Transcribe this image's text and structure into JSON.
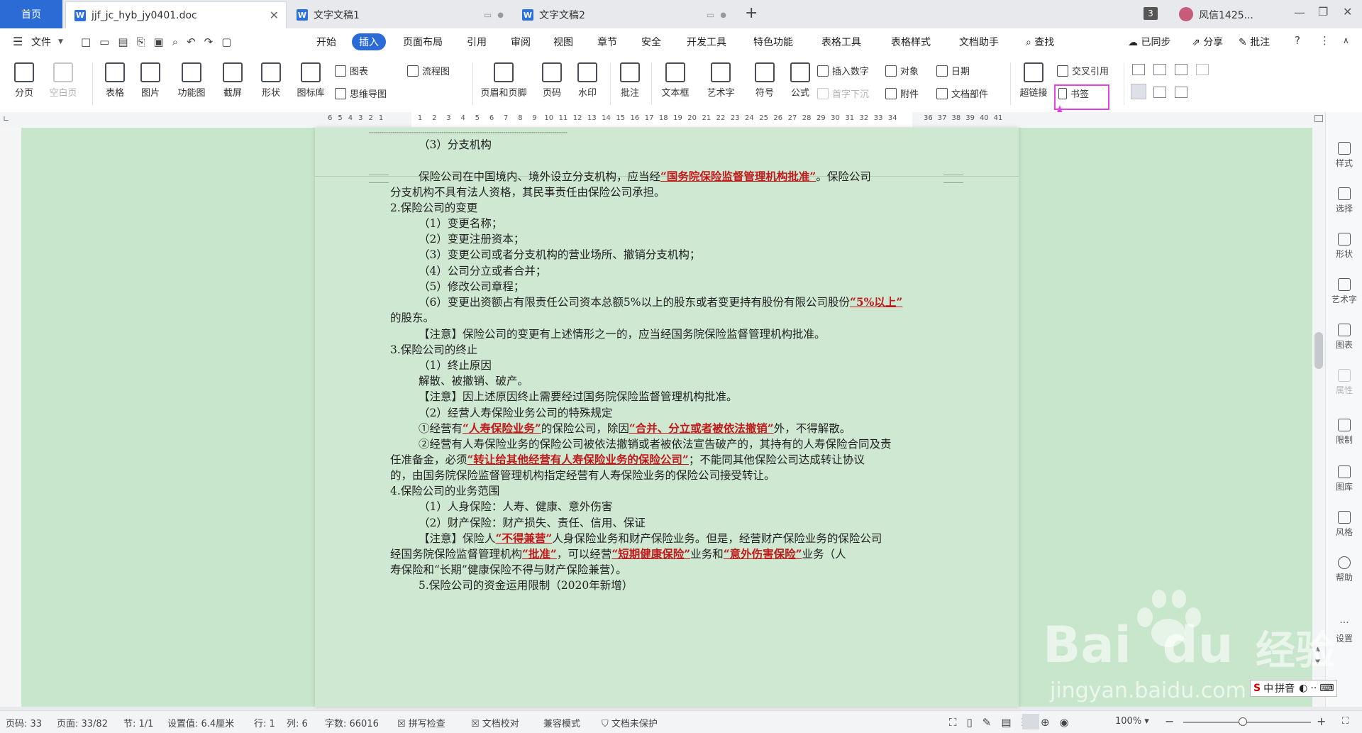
{
  "tabs": {
    "home": "首页",
    "items": [
      {
        "label": "jjf_jc_hyb_jy0401.doc",
        "icon": "W"
      },
      {
        "label": "文字文稿1",
        "icon": "W"
      },
      {
        "label": "文字文稿2",
        "icon": "W"
      }
    ],
    "new_tab": "+",
    "badge": "3",
    "user": "风信1425..."
  },
  "menubar": {
    "file": "文件",
    "items": [
      "开始",
      "插入",
      "页面布局",
      "引用",
      "审阅",
      "视图",
      "章节",
      "安全",
      "开发工具",
      "特色功能",
      "表格工具",
      "表格样式",
      "文档助手"
    ],
    "active": "插入",
    "search": "查找",
    "sync": "已同步",
    "share": "分享",
    "comment": "批注"
  },
  "ribbon": {
    "page_break": "分页",
    "blank_page": "空白页",
    "table": "表格",
    "picture": "图片",
    "function_chart": "功能图",
    "screenshot": "截屏",
    "shape": "形状",
    "icon_lib": "图标库",
    "chart": "图表",
    "mindmap": "思维导图",
    "flowchart": "流程图",
    "header_footer": "页眉和页脚",
    "page_number": "页码",
    "watermark": "水印",
    "comment": "批注",
    "textbox": "文本框",
    "wordart": "艺术字",
    "symbol": "符号",
    "formula": "公式",
    "insert_number": "插入数字",
    "object": "对象",
    "date": "日期",
    "dropcap": "首字下沉",
    "attachment": "附件",
    "doc_parts": "文档部件",
    "hyperlink": "超链接",
    "cross_ref": "交叉引用",
    "bookmark": "书签"
  },
  "ruler": {
    "left_ticks": [
      "6",
      "5",
      "4",
      "3",
      "2",
      "1"
    ],
    "ticks": [
      "1",
      "2",
      "3",
      "4",
      "5",
      "6",
      "7",
      "8",
      "9",
      "10",
      "11",
      "12",
      "13",
      "14",
      "15",
      "16",
      "17",
      "18",
      "19",
      "20",
      "21",
      "22",
      "23",
      "24",
      "25",
      "26",
      "27",
      "28",
      "29",
      "30",
      "31",
      "32",
      "33",
      "34"
    ],
    "right_ticks": [
      "36",
      "37",
      "38",
      "39",
      "40",
      "41"
    ]
  },
  "document": {
    "lines": [
      {
        "segs": [
          {
            "t": "（3）分支机构"
          }
        ]
      },
      {
        "segs": [
          {
            "t": "保险公司在中国境内、境外设立分支机构，应当经"
          },
          {
            "t": "“国务院保险监督管理机构批准”",
            "h": true
          },
          {
            "t": "。保险公司"
          }
        ]
      },
      {
        "segs": [
          {
            "t": "分支机构不具有法人资格，其民事责任由保险公司承担。"
          }
        ]
      },
      {
        "segs": [
          {
            "t": "2.保险公司的变更"
          }
        ]
      },
      {
        "segs": [
          {
            "t": "（1）变更名称；"
          }
        ]
      },
      {
        "segs": [
          {
            "t": "（2）变更注册资本；"
          }
        ]
      },
      {
        "segs": [
          {
            "t": "（3）变更公司或者分支机构的营业场所、撤销分支机构；"
          }
        ]
      },
      {
        "segs": [
          {
            "t": "（4）公司分立或者合并；"
          }
        ]
      },
      {
        "segs": [
          {
            "t": "（5）修改公司章程；"
          }
        ]
      },
      {
        "segs": [
          {
            "t": "（6）变更出资额占有限责任公司资本总额5%以上的股东或者变更持有股份有限公司股份"
          },
          {
            "t": "“5%以上”",
            "h": true
          }
        ]
      },
      {
        "segs": [
          {
            "t": "的股东。"
          }
        ]
      },
      {
        "segs": [
          {
            "t": "【注意】保险公司的变更有上述情形之一的，应当经国务院保险监督管理机构批准。"
          }
        ]
      },
      {
        "segs": [
          {
            "t": "3.保险公司的终止"
          }
        ]
      },
      {
        "segs": [
          {
            "t": "（1）终止原因"
          }
        ]
      },
      {
        "segs": [
          {
            "t": "解散、被撤销、破产。"
          }
        ]
      },
      {
        "segs": [
          {
            "t": "【注意】因上述原因终止需要经过国务院保险监督管理机构批准。"
          }
        ]
      },
      {
        "segs": [
          {
            "t": "（2）经营人寿保险业务公司的特殊规定"
          }
        ]
      },
      {
        "segs": [
          {
            "t": "①经营有"
          },
          {
            "t": "“人寿保险业务”",
            "h": true
          },
          {
            "t": "的保险公司，除因"
          },
          {
            "t": "“合并、分立或者被依法撤销”",
            "h": true
          },
          {
            "t": "外，不得解散。"
          }
        ]
      },
      {
        "segs": [
          {
            "t": "②经营有人寿保险业务的保险公司被依法撤销或者被依法宣告破产的，其持有的人寿保险合同及责"
          }
        ]
      },
      {
        "segs": [
          {
            "t": "任准备金，必须"
          },
          {
            "t": "“转让给其他经营有人寿保险业务的保险公司”",
            "h": true
          },
          {
            "t": "；不能同其他保险公司达成转让协议"
          }
        ]
      },
      {
        "segs": [
          {
            "t": "的，由国务院保险监督管理机构指定经营有人寿保险业务的保险公司接受转让。"
          }
        ]
      },
      {
        "segs": [
          {
            "t": "4.保险公司的业务范围"
          }
        ]
      },
      {
        "segs": [
          {
            "t": "（1）人身保险：人寿、健康、意外伤害"
          }
        ]
      },
      {
        "segs": [
          {
            "t": "（2）财产保险：财产损失、责任、信用、保证"
          }
        ]
      },
      {
        "segs": [
          {
            "t": "【注意】保险人"
          },
          {
            "t": "“不得兼营”",
            "h": true
          },
          {
            "t": "人身保险业务和财产保险业务。但是，经营财产保险业务的保险公司"
          }
        ]
      },
      {
        "segs": [
          {
            "t": "经国务院保险监督管理机构"
          },
          {
            "t": "“批准”",
            "h": true
          },
          {
            "t": "，可以经营"
          },
          {
            "t": "“短期健康保险”",
            "h": true
          },
          {
            "t": "业务和"
          },
          {
            "t": "“意外伤害保险”",
            "h": true
          },
          {
            "t": "业务（人"
          }
        ]
      },
      {
        "segs": [
          {
            "t": "寿保险和“长期”健康保险不得与财产保险兼营）。"
          }
        ]
      },
      {
        "segs": [
          {
            "t": "5.保险公司的资金运用限制（2020年新增）"
          }
        ]
      }
    ]
  },
  "sidebar": [
    "样式",
    "选择",
    "形状",
    "艺术字",
    "图表",
    "属性",
    "限制",
    "图库",
    "风格",
    "帮助",
    "设置"
  ],
  "statusbar": {
    "page_code": "页码: 33",
    "page": "页面: 33/82",
    "section": "节: 1/1",
    "setting": "设置值: 6.4厘米",
    "row": "行: 1",
    "col": "列: 6",
    "wordcount": "字数: 66016",
    "spellcheck": "拼写检查",
    "proofread": "文档校对",
    "compat": "兼容模式",
    "protect": "文档未保护",
    "zoom": "100%"
  },
  "ime": "拼音",
  "watermark": {
    "brand": "Bai",
    "brand2": "du",
    "cn": "经验",
    "url": "jingyan.baidu.com"
  }
}
